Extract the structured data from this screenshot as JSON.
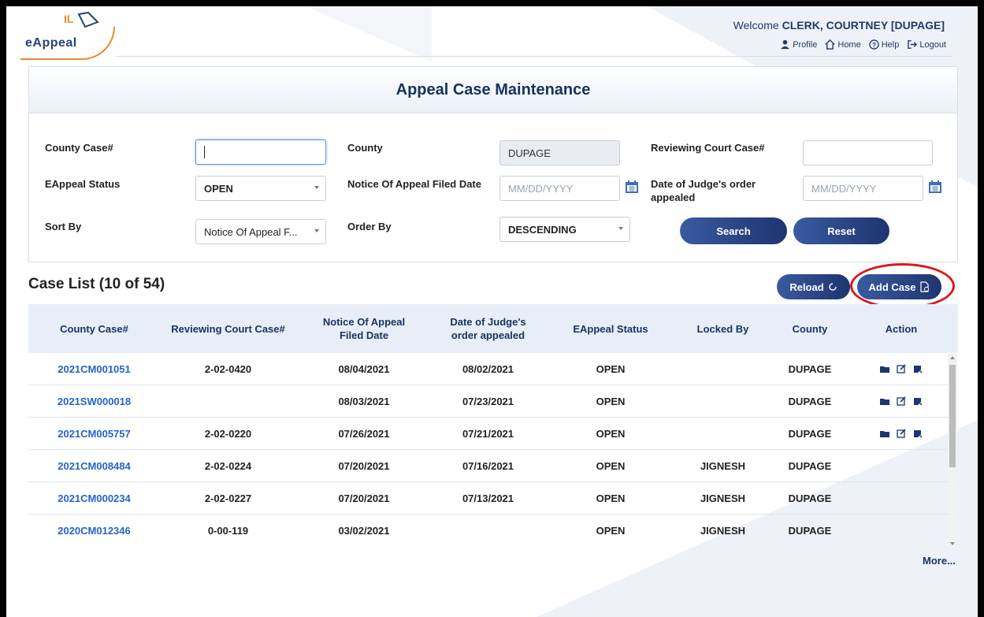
{
  "header": {
    "logo_top": "IL",
    "logo_text": "eAppeal",
    "welcome_label": "Welcome",
    "user": "CLERK, COURTNEY",
    "county_tag": "[DUPAGE]",
    "links": [
      {
        "label": "Profile",
        "icon": "user-icon"
      },
      {
        "label": "Home",
        "icon": "home-icon"
      },
      {
        "label": "Help",
        "icon": "help-icon"
      },
      {
        "label": "Logout",
        "icon": "logout-icon"
      }
    ]
  },
  "panel": {
    "title": "Appeal Case Maintenance",
    "county_case_label": "County Case#",
    "county_case_value": "",
    "county_label": "County",
    "county_value": "DUPAGE",
    "reviewing_label": "Reviewing Court Case#",
    "reviewing_value": "",
    "status_label": "EAppeal Status",
    "status_value": "OPEN",
    "notice_label": "Notice Of Appeal Filed Date",
    "notice_placeholder": "MM/DD/YYYY",
    "judge_label": "Date of Judge's order appealed",
    "judge_placeholder": "MM/DD/YYYY",
    "sort_label": "Sort By",
    "sort_value": "Notice Of Appeal F...",
    "order_label": "Order By",
    "order_value": "DESCENDING",
    "search_label": "Search",
    "reset_label": "Reset"
  },
  "case_list": {
    "title": "Case List (10 of 54)",
    "reload_label": "Reload",
    "add_label": "Add Case",
    "more_label": "More...",
    "columns": [
      "County Case#",
      "Reviewing Court Case#",
      "Notice Of Appeal Filed Date",
      "Date of Judge's order appealed",
      "EAppeal Status",
      "Locked By",
      "County",
      "Action"
    ],
    "rows": [
      {
        "case": "2021CM001051",
        "reviewing": "2-02-0420",
        "notice": "08/04/2021",
        "judge": "08/02/2021",
        "status": "OPEN",
        "locked": "",
        "county": "DUPAGE",
        "actions": true
      },
      {
        "case": "2021SW000018",
        "reviewing": "",
        "notice": "08/03/2021",
        "judge": "07/23/2021",
        "status": "OPEN",
        "locked": "",
        "county": "DUPAGE",
        "actions": true
      },
      {
        "case": "2021CM005757",
        "reviewing": "2-02-0220",
        "notice": "07/26/2021",
        "judge": "07/21/2021",
        "status": "OPEN",
        "locked": "",
        "county": "DUPAGE",
        "actions": true
      },
      {
        "case": "2021CM008484",
        "reviewing": "2-02-0224",
        "notice": "07/20/2021",
        "judge": "07/16/2021",
        "status": "OPEN",
        "locked": "JIGNESH",
        "county": "DUPAGE",
        "actions": false
      },
      {
        "case": "2021CM000234",
        "reviewing": "2-02-0227",
        "notice": "07/20/2021",
        "judge": "07/13/2021",
        "status": "OPEN",
        "locked": "JIGNESH",
        "county": "DUPAGE",
        "actions": false
      },
      {
        "case": "2020CM012346",
        "reviewing": "0-00-119",
        "notice": "03/02/2021",
        "judge": "",
        "status": "OPEN",
        "locked": "JIGNESH",
        "county": "DUPAGE",
        "actions": false
      }
    ]
  },
  "colors": {
    "primary": "#1e3570",
    "link": "#2563c9",
    "highlight_ring": "#d8181e",
    "logo_accent": "#e8892f"
  }
}
